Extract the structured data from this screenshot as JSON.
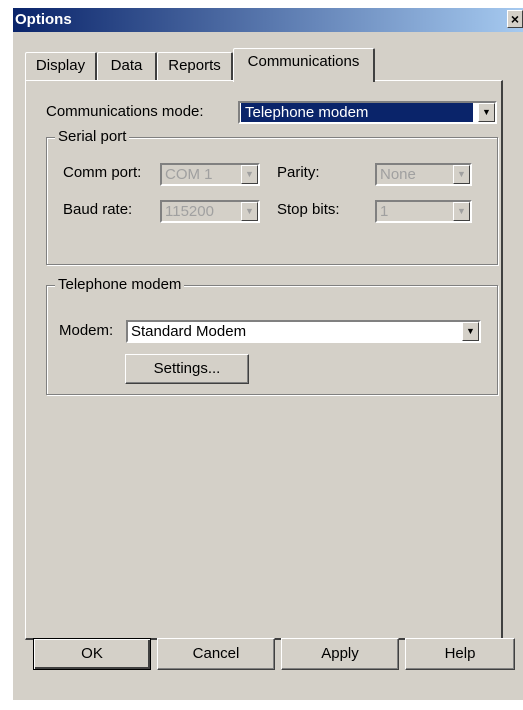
{
  "window": {
    "title": "Options",
    "close_glyph": "×"
  },
  "tabs": [
    {
      "label": "Display"
    },
    {
      "label": "Data"
    },
    {
      "label": "Reports"
    },
    {
      "label": "Communications",
      "active": true
    }
  ],
  "communications": {
    "mode_label": "Communications mode:",
    "mode_value": "Telephone modem"
  },
  "serial_port": {
    "group_title": "Serial port",
    "comm_port_label": "Comm port:",
    "comm_port_value": "COM 1",
    "parity_label": "Parity:",
    "parity_value": "None",
    "baud_rate_label": "Baud rate:",
    "baud_rate_value": "115200",
    "stop_bits_label": "Stop bits:",
    "stop_bits_value": "1"
  },
  "telephone_modem": {
    "group_title": "Telephone modem",
    "modem_label": "Modem:",
    "modem_value": "Standard Modem",
    "settings_button": "Settings..."
  },
  "buttons": {
    "ok": "OK",
    "cancel": "Cancel",
    "apply": "Apply",
    "help": "Help"
  },
  "icons": {
    "dropdown_arrow": "▼"
  },
  "colors": {
    "title_bar": "#0a246a",
    "dialog_face": "#d4d0c8",
    "selection": "#0a246a"
  }
}
